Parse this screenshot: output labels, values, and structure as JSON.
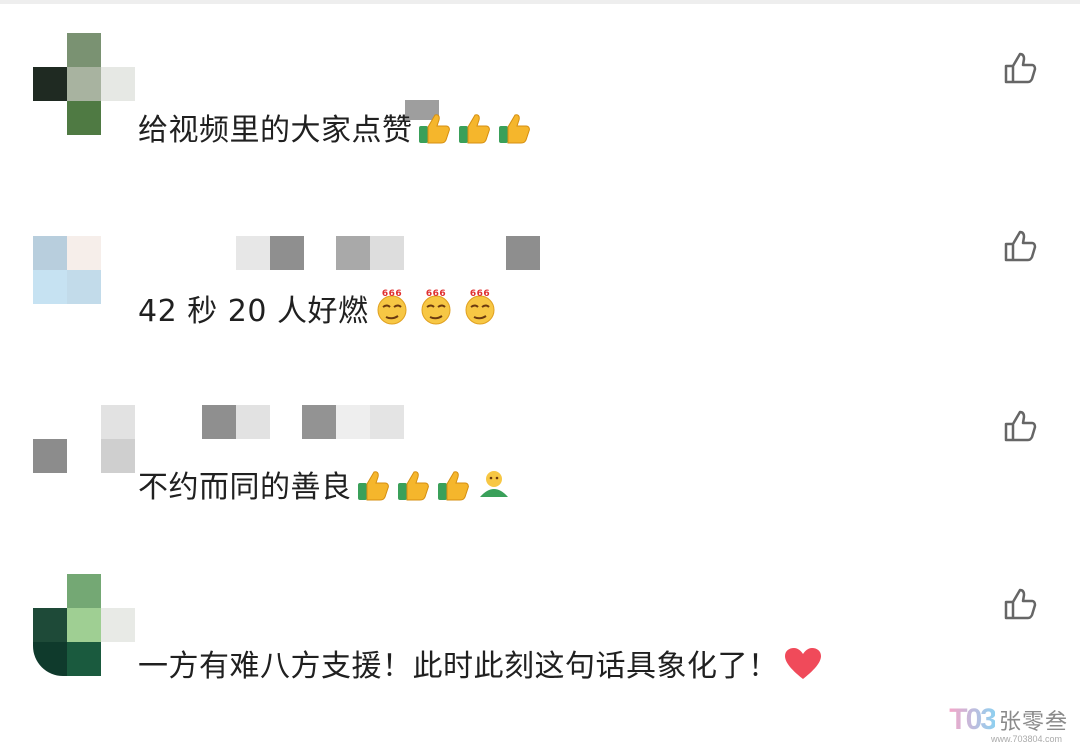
{
  "comments": [
    {
      "text": "给视频里的大家点赞",
      "emoji": [
        "thumbs-up",
        "thumbs-up",
        "thumbs-up"
      ]
    },
    {
      "text": "42 秒 20 人好燃",
      "emoji": [
        "666-smirk",
        "666-smirk",
        "666-smirk"
      ]
    },
    {
      "text": "不约而同的善良",
      "emoji": [
        "thumbs-up",
        "thumbs-up",
        "thumbs-up",
        "green-person-hug"
      ]
    },
    {
      "text": "一方有难八方支援！此时此刻这句话具象化了！",
      "emoji": [
        "red-heart"
      ]
    }
  ],
  "watermark": {
    "logo": "T03",
    "text": "张零叁",
    "sub": "www.703804.com"
  },
  "colors": {
    "like_icon": "#666666",
    "heart": "#f04a5a",
    "thumb": "#f5b62c",
    "cuff": "#3aa05a"
  }
}
